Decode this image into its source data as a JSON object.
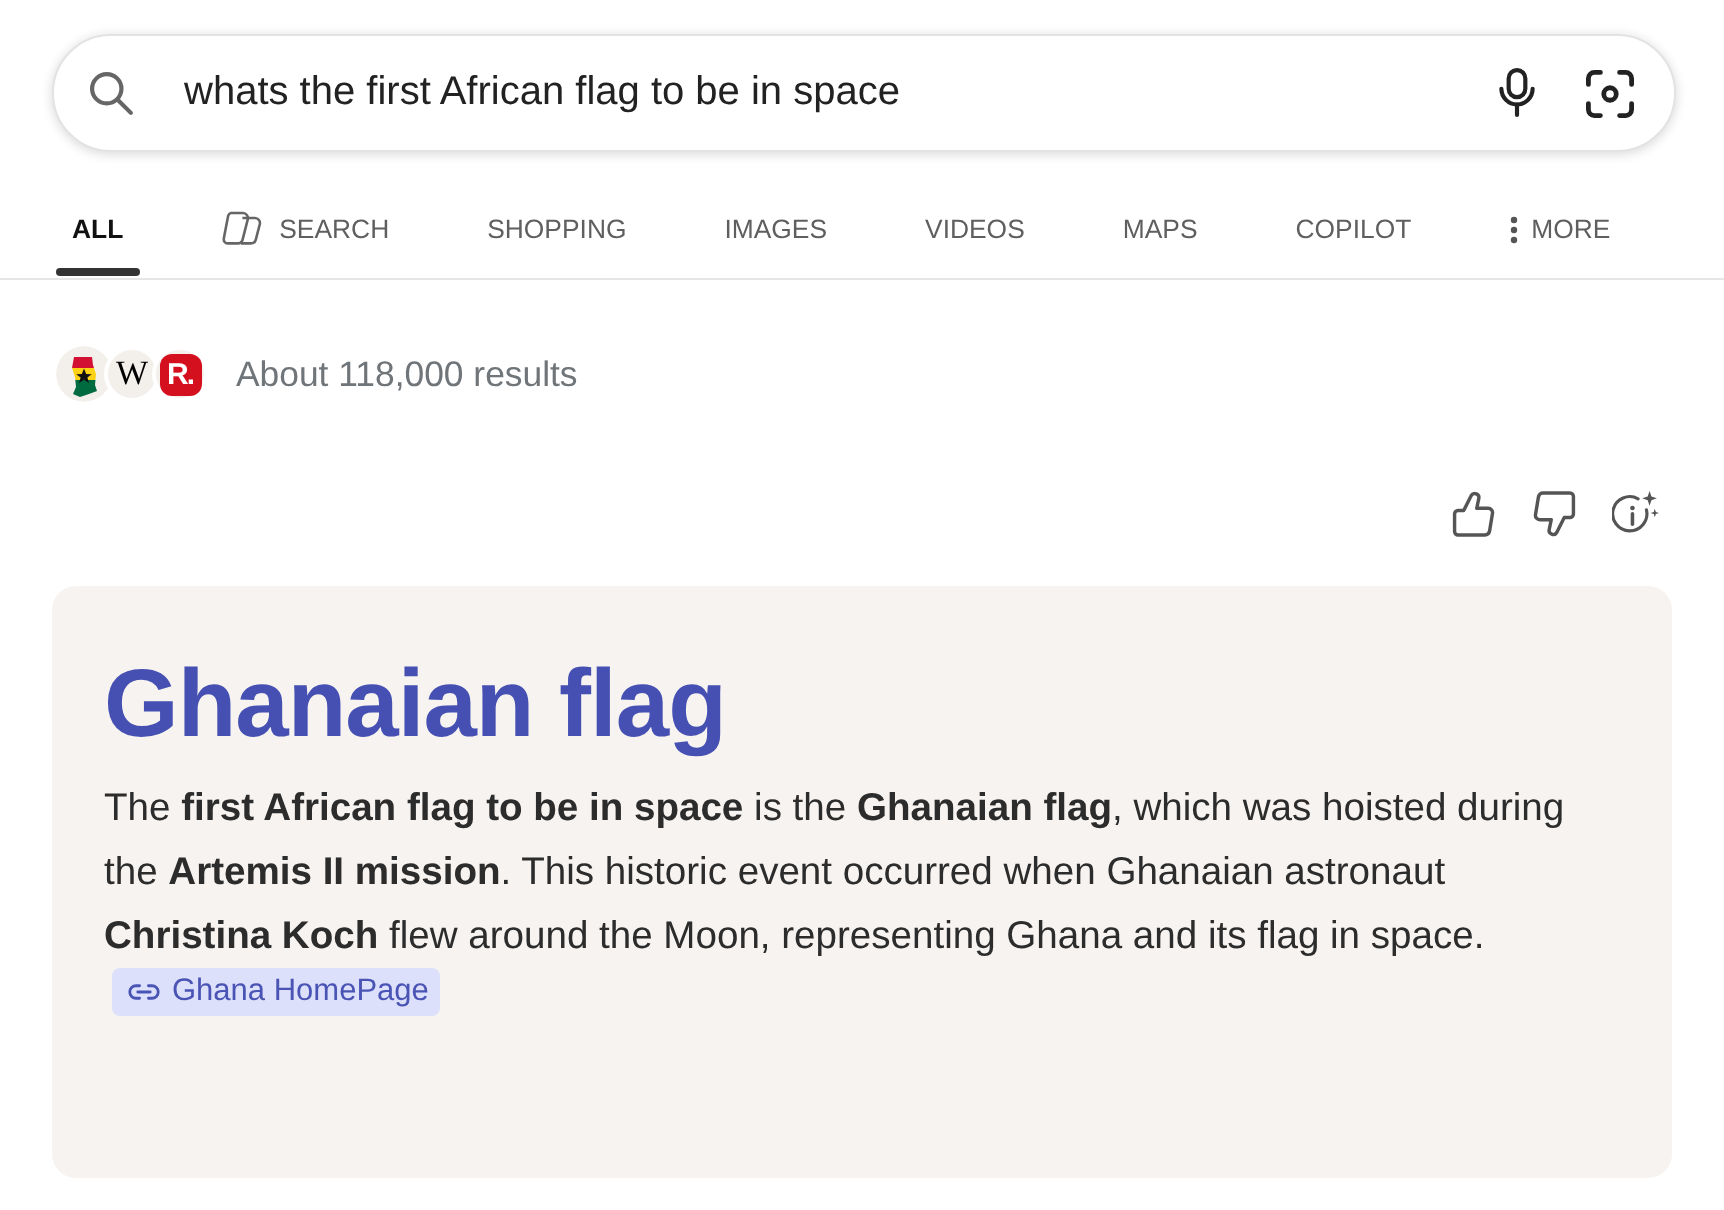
{
  "search": {
    "query": "whats the first African flag to be in space"
  },
  "tabs": [
    {
      "label": "ALL",
      "selected": true,
      "kind": "plain"
    },
    {
      "label": "SEARCH",
      "selected": false,
      "kind": "copilot"
    },
    {
      "label": "SHOPPING",
      "selected": false,
      "kind": "plain"
    },
    {
      "label": "IMAGES",
      "selected": false,
      "kind": "plain"
    },
    {
      "label": "VIDEOS",
      "selected": false,
      "kind": "plain"
    },
    {
      "label": "MAPS",
      "selected": false,
      "kind": "plain"
    },
    {
      "label": "COPILOT",
      "selected": false,
      "kind": "plain"
    },
    {
      "label": "MORE",
      "selected": false,
      "kind": "more"
    }
  ],
  "results": {
    "sources": [
      {
        "kind": "flag-map"
      },
      {
        "kind": "letter",
        "glyph": "W"
      },
      {
        "kind": "badge",
        "glyph": "R."
      }
    ],
    "count": "About 118,000 results"
  },
  "answer": {
    "title": "Ghanaian flag",
    "text": "The **first African flag to be in space** is the **Ghanaian flag**, which was hoisted during the **Artemis II mission**. This historic event occurred when Ghanaian astronaut **Christina Koch** flew around the Moon, representing Ghana and its flag in space.",
    "link": {
      "label": "Ghana HomePage"
    }
  }
}
